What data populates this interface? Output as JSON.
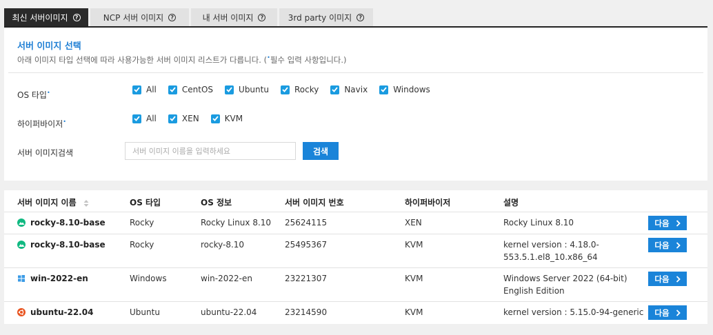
{
  "tabs": [
    {
      "label": "최신 서버이미지",
      "active": true
    },
    {
      "label": "NCP 서버 이미지",
      "active": false
    },
    {
      "label": "내 서버 이미지",
      "active": false
    },
    {
      "label": "3rd party 이미지",
      "active": false
    }
  ],
  "panel": {
    "title": "서버 이미지 선택",
    "desc_before": "아래 이미지 타입 선택에 따라 사용가능한 서버 이미지 리스트가 다릅니다. (",
    "desc_after": "필수 입력 사항입니다.)",
    "required_dot": "•"
  },
  "filters": {
    "os_label": "OS 타입",
    "os_options": [
      "All",
      "CentOS",
      "Ubuntu",
      "Rocky",
      "Navix",
      "Windows"
    ],
    "hv_label": "하이퍼바이저",
    "hv_options": [
      "All",
      "XEN",
      "KVM"
    ],
    "search_label": "서버 이미지검색",
    "search_placeholder": "서버 이미지 이름을 입력하세요",
    "search_button": "검색"
  },
  "table": {
    "headers": [
      "서버 이미지 이름",
      "OS 타입",
      "OS 정보",
      "서버 이미지 번호",
      "하이퍼바이저",
      "설명"
    ],
    "rows": [
      {
        "icon": "rocky-icon",
        "name": "rocky-8.10-base",
        "os_type": "Rocky",
        "os_info": "Rocky Linux 8.10",
        "image_no": "25624115",
        "hypervisor": "XEN",
        "desc1": "Rocky Linux 8.10",
        "desc2": "",
        "button": "다음"
      },
      {
        "icon": "rocky-icon",
        "name": "rocky-8.10-base",
        "os_type": "Rocky",
        "os_info": "rocky-8.10",
        "image_no": "25495367",
        "hypervisor": "KVM",
        "desc1": "kernel version : 4.18.0-",
        "desc2": "553.5.1.el8_10.x86_64",
        "button": "다음"
      },
      {
        "icon": "windows-icon",
        "name": "win-2022-en",
        "os_type": "Windows",
        "os_info": "win-2022-en",
        "image_no": "23221307",
        "hypervisor": "KVM",
        "desc1": "Windows Server 2022 (64-bit)",
        "desc2": "English Edition",
        "button": "다음"
      },
      {
        "icon": "ubuntu-icon",
        "name": "ubuntu-22.04",
        "os_type": "Ubuntu",
        "os_info": "ubuntu-22.04",
        "image_no": "23214590",
        "hypervisor": "KVM",
        "desc1": "kernel version : 5.15.0-94-generic",
        "desc2": "",
        "button": "다음"
      }
    ]
  },
  "colors": {
    "accent": "#1a84d9",
    "checkbox": "#1a9be0",
    "title": "#1f7fd4",
    "rocky": "#10b981",
    "windows": "#3b9be6",
    "ubuntu": "#e95420"
  }
}
